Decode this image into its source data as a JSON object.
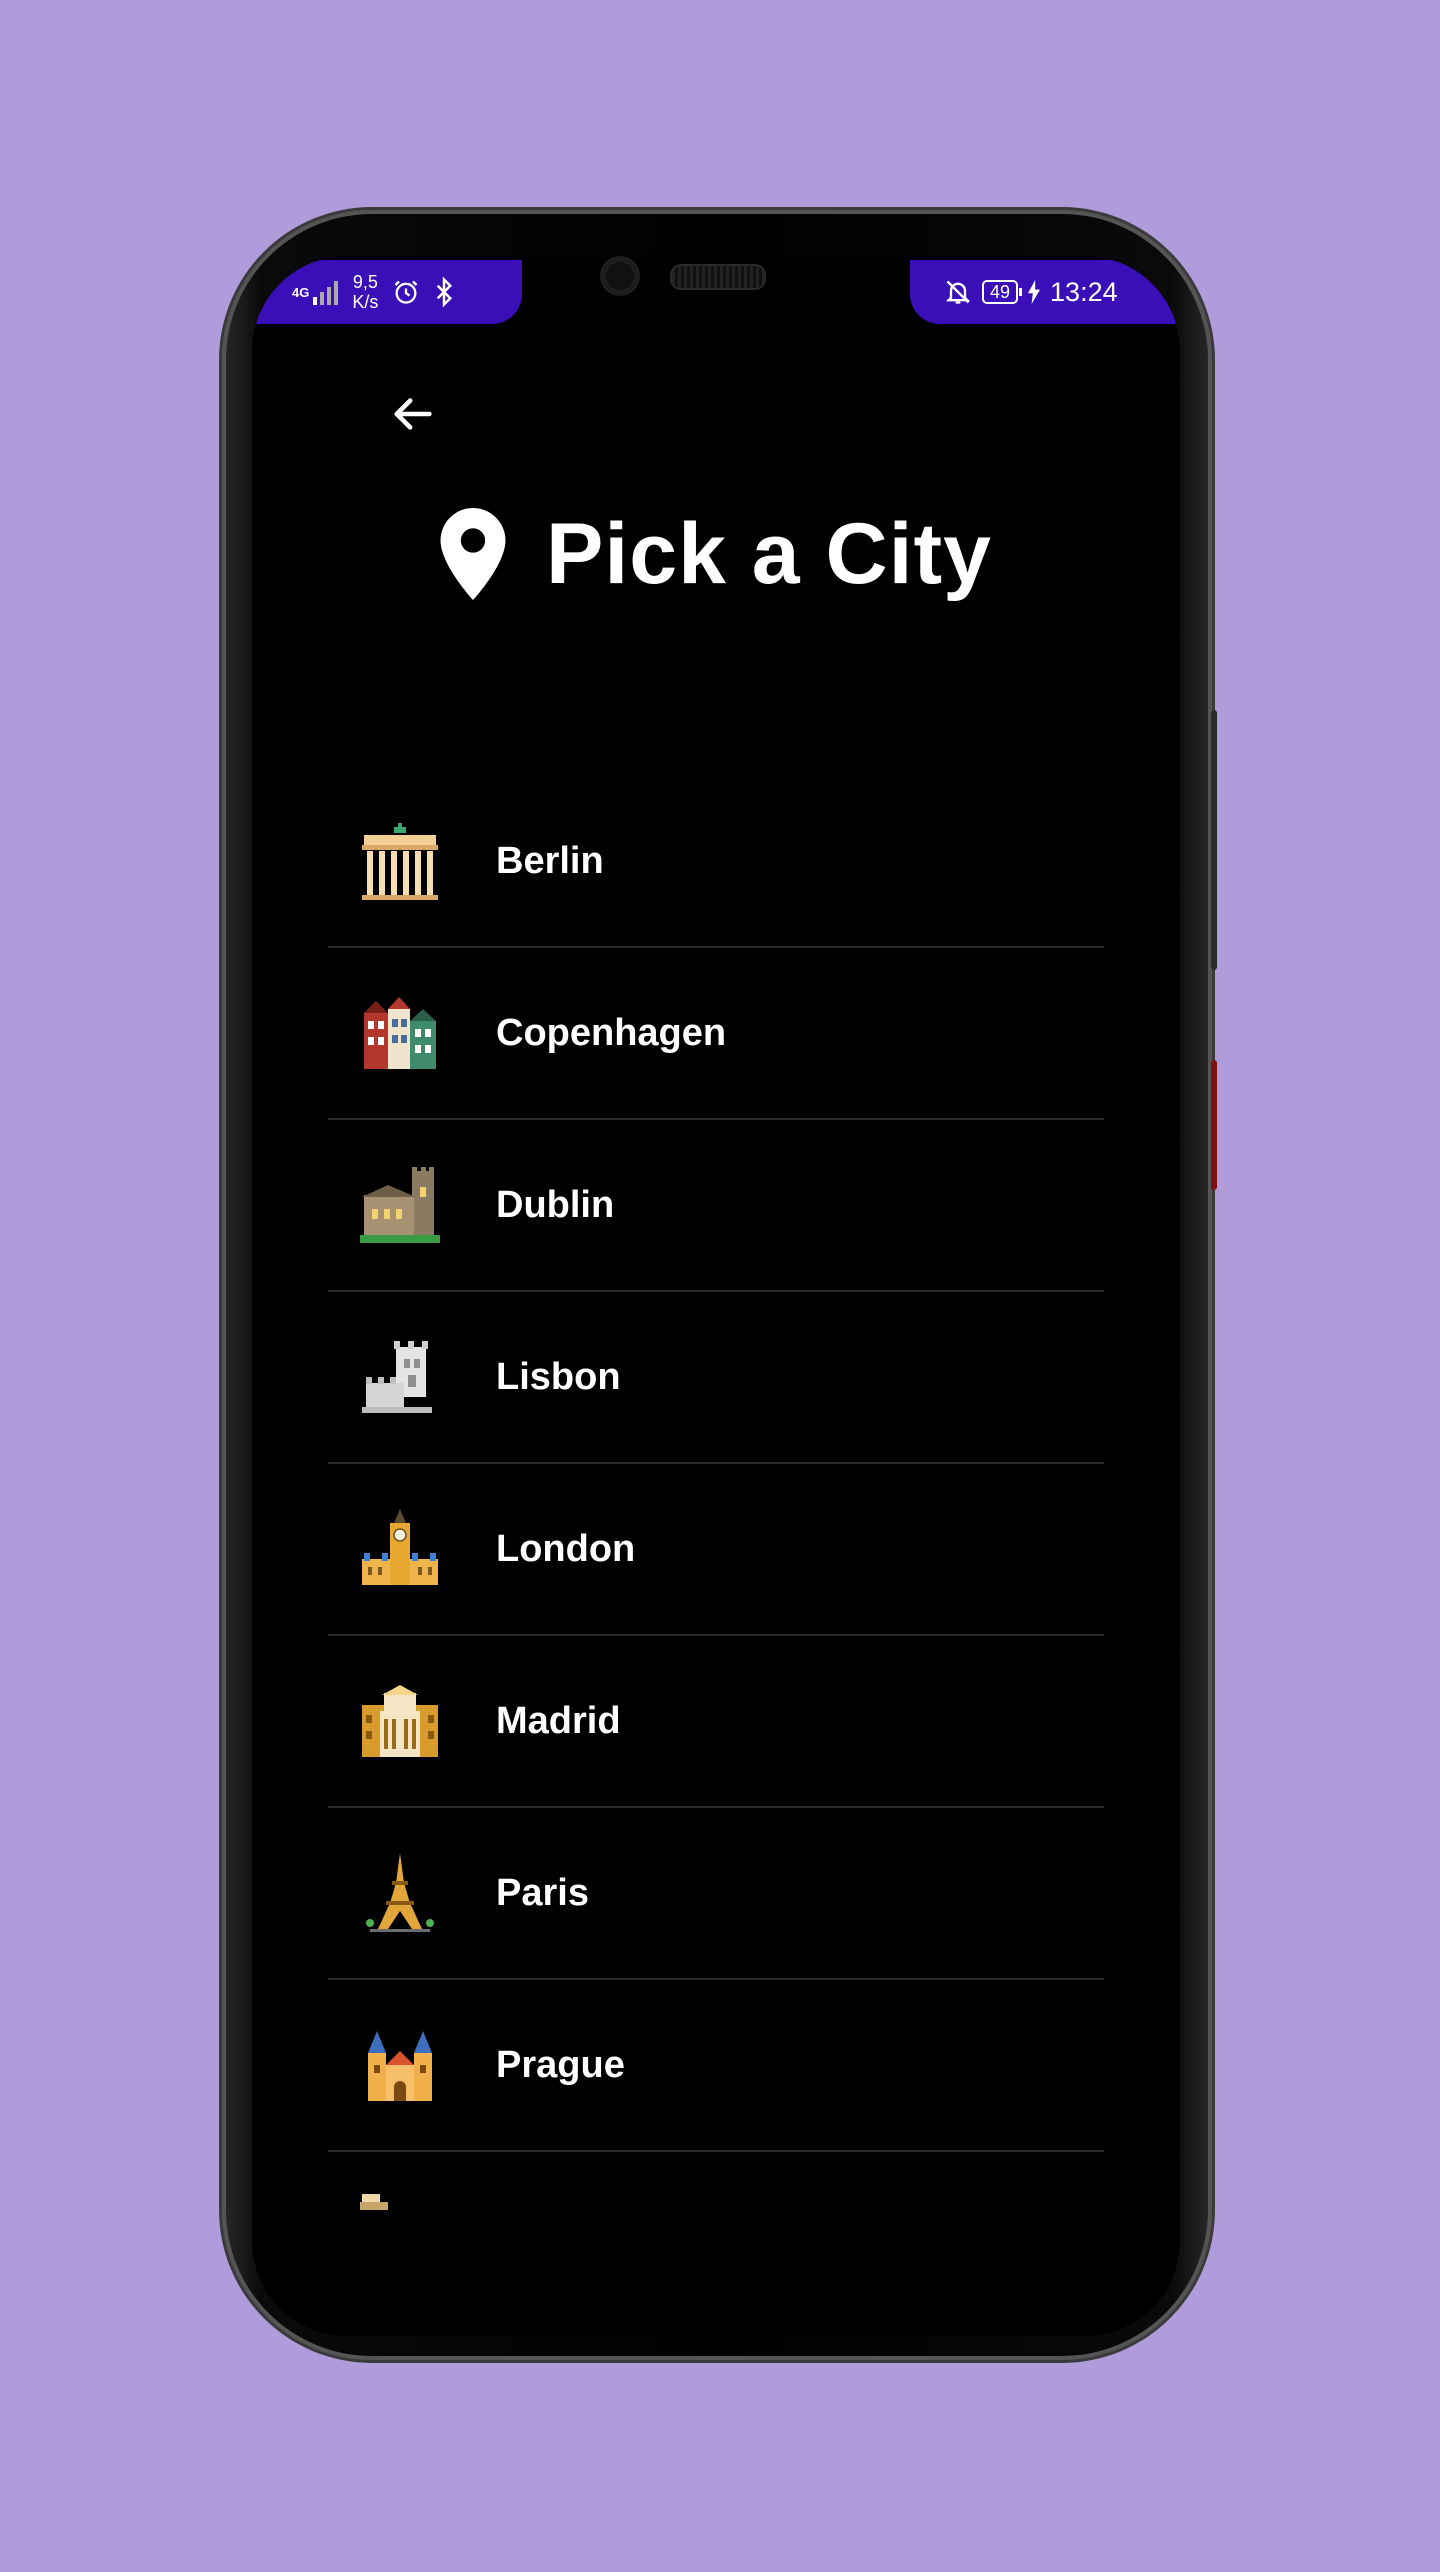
{
  "status_bar": {
    "network_type": "4G",
    "speed_value": "9,5",
    "speed_unit": "K/s",
    "battery_level": "49",
    "time": "13:24"
  },
  "header": {
    "title": "Pick a City",
    "back_icon": "arrow-left-icon",
    "title_icon": "location-pin-icon"
  },
  "cities": [
    {
      "name": "Berlin",
      "icon": "brandenburg-gate-icon"
    },
    {
      "name": "Copenhagen",
      "icon": "nyhavn-houses-icon"
    },
    {
      "name": "Dublin",
      "icon": "castle-icon"
    },
    {
      "name": "Lisbon",
      "icon": "belem-tower-icon"
    },
    {
      "name": "London",
      "icon": "big-ben-icon"
    },
    {
      "name": "Madrid",
      "icon": "palace-icon"
    },
    {
      "name": "Paris",
      "icon": "eiffel-tower-icon"
    },
    {
      "name": "Prague",
      "icon": "cathedral-icon"
    }
  ],
  "colors": {
    "background": "#b19cdb",
    "status_bar": "#3a0fb8",
    "screen": "#000000",
    "text": "#ffffff",
    "divider": "#2a2a2a"
  }
}
